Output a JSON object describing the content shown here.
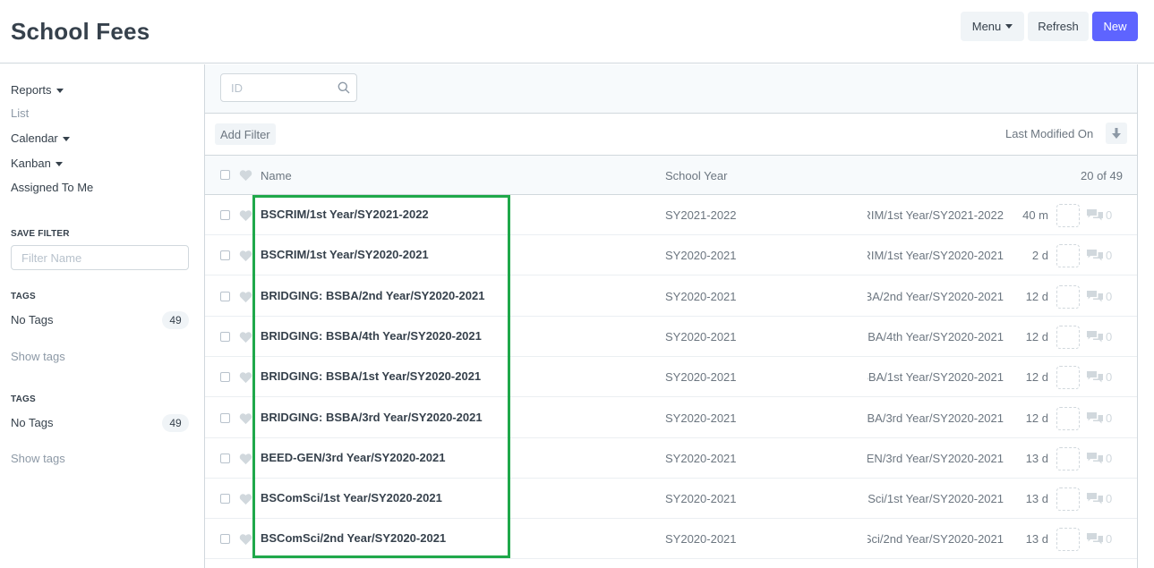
{
  "header": {
    "title": "School Fees",
    "menu_label": "Menu",
    "refresh_label": "Refresh",
    "new_label": "New"
  },
  "sidebar": {
    "reports": "Reports",
    "list": "List",
    "calendar": "Calendar",
    "kanban": "Kanban",
    "assigned": "Assigned To Me",
    "save_filter_label": "SAVE FILTER",
    "filter_placeholder": "Filter Name",
    "tag_groups": [
      {
        "label": "TAGS",
        "no_tags": "No Tags",
        "count": "49",
        "show": "Show tags"
      },
      {
        "label": "TAGS",
        "no_tags": "No Tags",
        "count": "49",
        "show": "Show tags"
      }
    ]
  },
  "list": {
    "search_placeholder": "ID",
    "add_filter": "Add Filter",
    "sort_label": "Last Modified On",
    "columns": {
      "name": "Name",
      "school_year": "School Year"
    },
    "count": "20 of 49",
    "rows": [
      {
        "name": "BSCRIM/1st Year/SY2021-2022",
        "school_year": "SY2021-2022",
        "title": "BSCRIM/1st Year/SY2021-2022",
        "modified": "40 m",
        "comments": "0"
      },
      {
        "name": "BSCRIM/1st Year/SY2020-2021",
        "school_year": "SY2020-2021",
        "title": "BSCRIM/1st Year/SY2020-2021",
        "modified": "2 d",
        "comments": "0"
      },
      {
        "name": "BRIDGING: BSBA/2nd Year/SY2020-2021",
        "school_year": "SY2020-2021",
        "title": "BRIDGING: BSBA/2nd Year/SY2020-2021",
        "modified": "12 d",
        "comments": "0"
      },
      {
        "name": "BRIDGING: BSBA/4th Year/SY2020-2021",
        "school_year": "SY2020-2021",
        "title": "BRIDGING: BSBA/4th Year/SY2020-2021",
        "modified": "12 d",
        "comments": "0"
      },
      {
        "name": "BRIDGING: BSBA/1st Year/SY2020-2021",
        "school_year": "SY2020-2021",
        "title": "BRIDGING: BSBA/1st Year/SY2020-2021",
        "modified": "12 d",
        "comments": "0"
      },
      {
        "name": "BRIDGING: BSBA/3rd Year/SY2020-2021",
        "school_year": "SY2020-2021",
        "title": "BRIDGING: BSBA/3rd Year/SY2020-2021",
        "modified": "12 d",
        "comments": "0"
      },
      {
        "name": "BEED-GEN/3rd Year/SY2020-2021",
        "school_year": "SY2020-2021",
        "title": "BEED-GEN/3rd Year/SY2020-2021",
        "modified": "13 d",
        "comments": "0"
      },
      {
        "name": "BSComSci/1st Year/SY2020-2021",
        "school_year": "SY2020-2021",
        "title": "BSComSci/1st Year/SY2020-2021",
        "modified": "13 d",
        "comments": "0"
      },
      {
        "name": "BSComSci/2nd Year/SY2020-2021",
        "school_year": "SY2020-2021",
        "title": "BSComSci/2nd Year/SY2020-2021",
        "modified": "13 d",
        "comments": "0"
      }
    ]
  },
  "colors": {
    "primary": "#5e64ff",
    "highlight": "#1fa84a"
  },
  "icons": [
    "caret-down-icon",
    "search-icon",
    "sort-arrow-down-icon",
    "heart-icon",
    "comment-icon"
  ]
}
